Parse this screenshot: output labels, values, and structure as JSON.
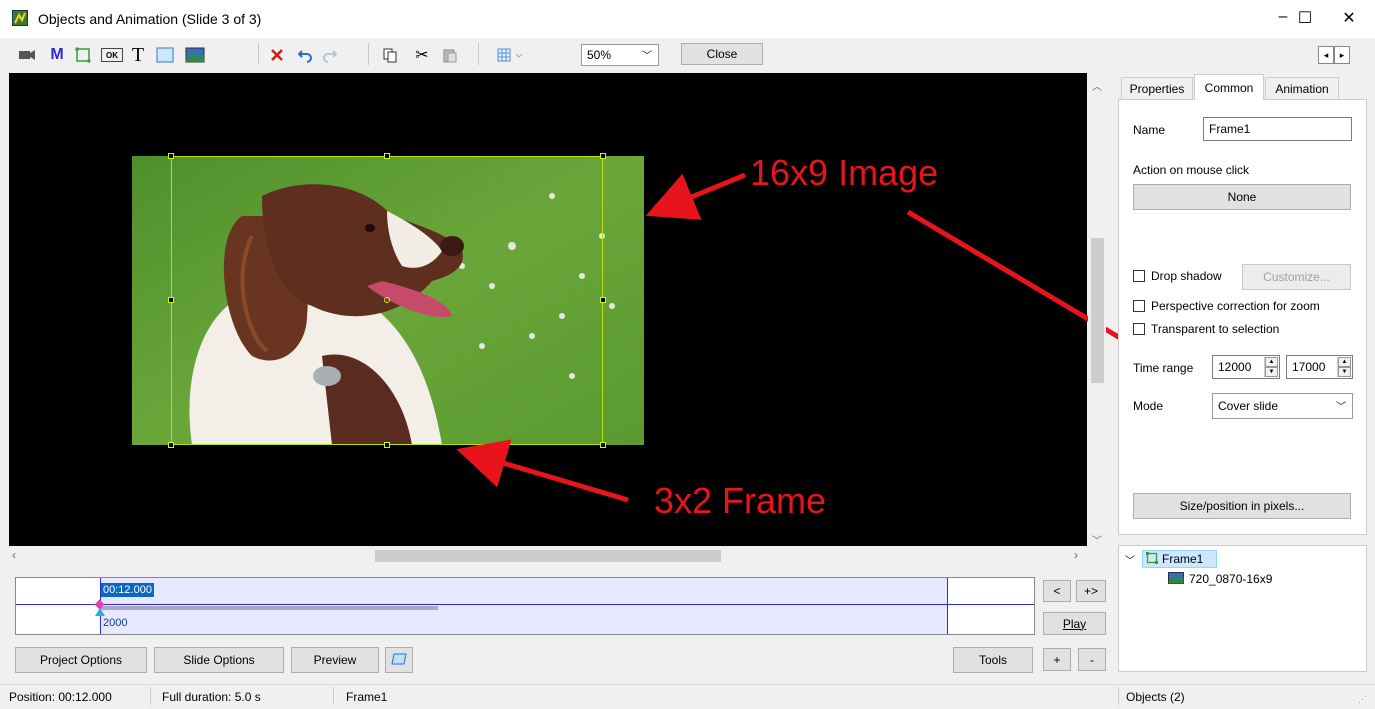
{
  "window": {
    "title": "Objects and Animation  (Slide 3 of 3)",
    "minimize": "–",
    "maximize": "☐",
    "close": "✕"
  },
  "toolbar": {
    "m_label": "M",
    "ok_label": "OK",
    "t_label": "T",
    "zoom_value": "50%",
    "close_label": "Close",
    "nav_left": "◂",
    "nav_right": "▸"
  },
  "annotations": {
    "image_label": "16x9 Image",
    "frame_label": "3x2 Frame"
  },
  "right_panel": {
    "tabs": [
      "Properties",
      "Common",
      "Animation"
    ],
    "active_tab": "Common",
    "name_label": "Name",
    "name_value": "Frame1",
    "action_label": "Action on mouse click",
    "action_value": "None",
    "drop_shadow_label": "Drop shadow",
    "customize_label": "Customize...",
    "perspective_label": "Perspective correction for zoom",
    "transparent_label": "Transparent to selection",
    "time_range_label": "Time range",
    "time_start": "12000",
    "time_end": "17000",
    "mode_label": "Mode",
    "mode_value": "Cover slide",
    "size_position_label": "Size/position in pixels..."
  },
  "tree": {
    "root_label": "Frame1",
    "child_label": "720_0870-16x9"
  },
  "timeline": {
    "time_marker": "00:12.000",
    "bottom_value": "2000",
    "prev_label": "<",
    "next_label": "+>",
    "play_label": "Play",
    "plus_label": "+",
    "minus_label": "-"
  },
  "bottom_buttons": {
    "project_options": "Project Options",
    "slide_options": "Slide Options",
    "preview": "Preview",
    "tools": "Tools"
  },
  "status": {
    "position": "Position: 00:12.000",
    "duration": "Full duration: 5.0 s",
    "object": "Frame1",
    "objects_count": "Objects (2)"
  },
  "colors": {
    "annotation_red": "#e8141b",
    "frame_outline": "#b8e000",
    "timeline_blue": "#0a68c4",
    "selection_bg": "#cce8ff"
  }
}
